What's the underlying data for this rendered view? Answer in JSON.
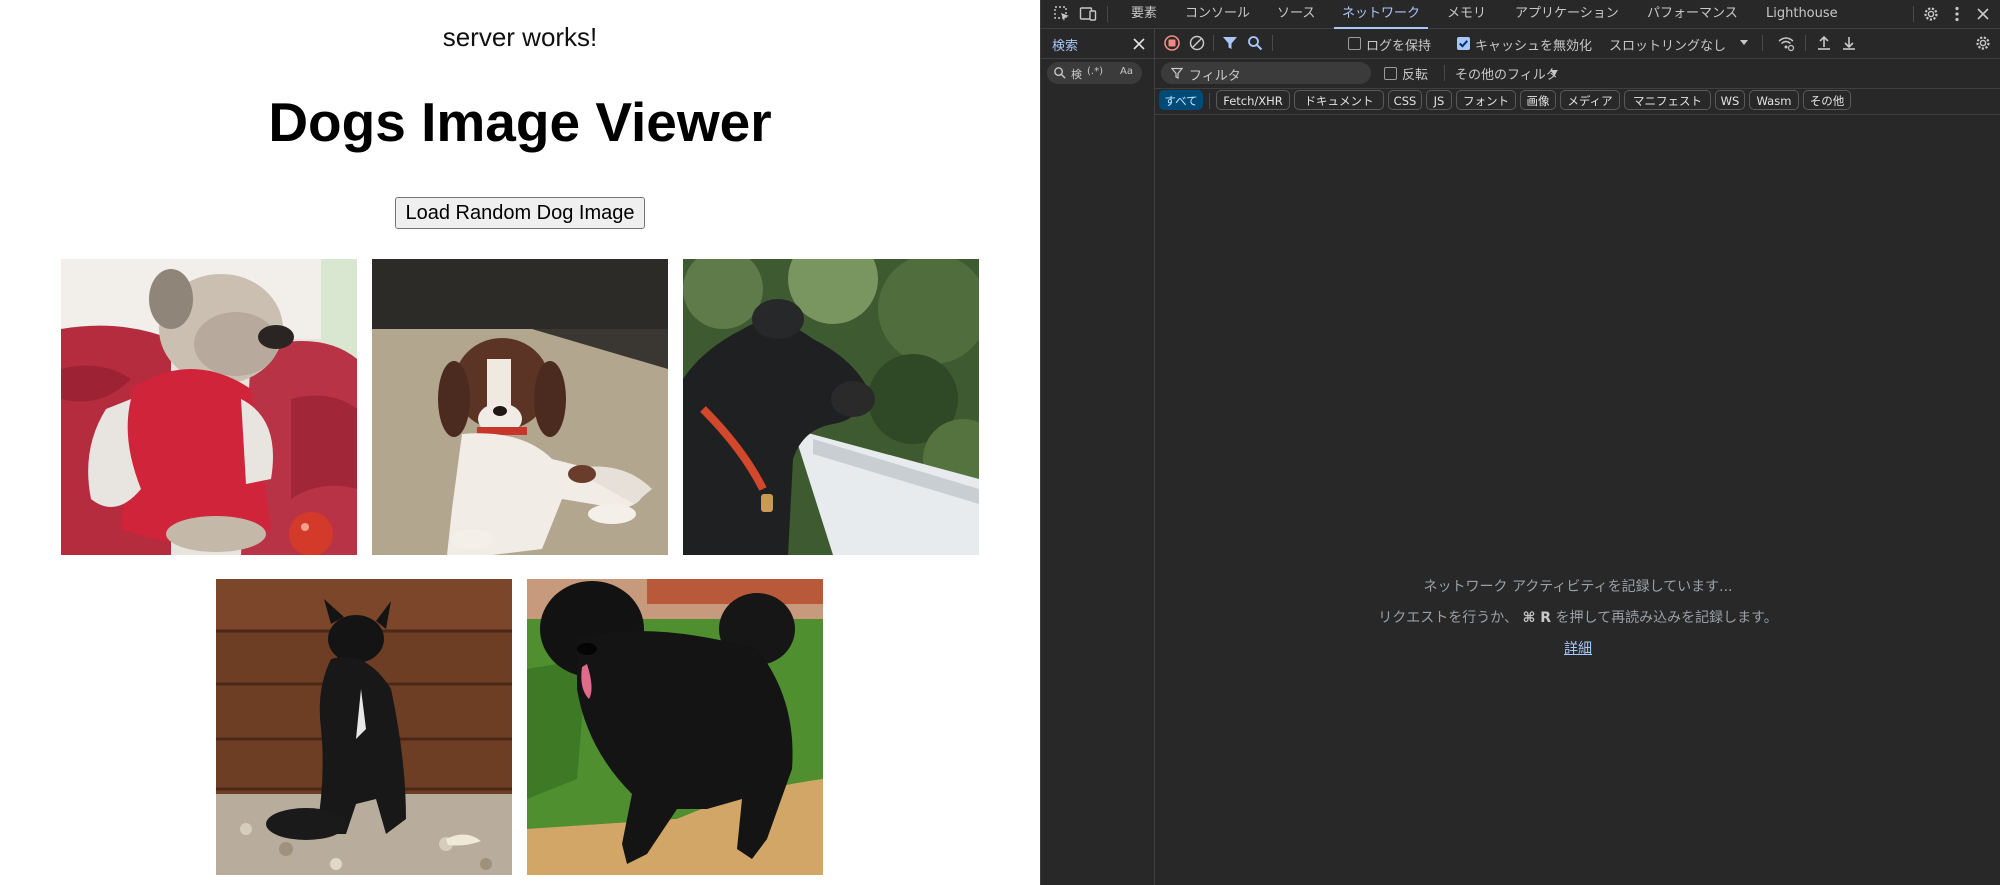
{
  "page": {
    "server_status": "server works!",
    "title": "Dogs Image Viewer",
    "load_button": "Load Random Dog Image",
    "images": [
      {
        "subject": "wire-haired terrier in red costume on sofa"
      },
      {
        "subject": "brown and white spaniel lying on carpet"
      },
      {
        "subject": "black terrier profile with red collar"
      },
      {
        "subject": "black dog sitting on gravel"
      },
      {
        "subject": "large black fluffy dog on dirt"
      }
    ]
  },
  "devtools": {
    "tabs": [
      "要素",
      "コンソール",
      "ソース",
      "ネットワーク",
      "メモリ",
      "アプリケーション",
      "パフォーマンス",
      "Lighthouse"
    ],
    "active_tab": "ネットワーク",
    "search_panel": {
      "label": "検索",
      "search_placeholder": "検",
      "regex_toggle": "(.*)",
      "case_toggle": "Aa"
    },
    "toolbar": {
      "preserve_log": "ログを保持",
      "preserve_log_checked": false,
      "disable_cache": "キャッシュを無効化",
      "disable_cache_checked": true,
      "throttling": "スロットリングなし"
    },
    "filter": {
      "placeholder": "フィルタ",
      "invert": "反転",
      "invert_checked": false,
      "more_filters": "その他のフィルタ"
    },
    "type_filters": [
      "すべて",
      "Fetch/XHR",
      "ドキュメント",
      "CSS",
      "JS",
      "フォント",
      "画像",
      "メディア",
      "マニフェスト",
      "WS",
      "Wasm",
      "その他"
    ],
    "active_type_filter": "すべて",
    "empty_state": {
      "line1": "ネットワーク アクティビティを記録しています...",
      "line2_prefix": "リクエストを行うか、",
      "shortcut": "⌘ R",
      "line2_suffix": "を押して再読み込みを記録します。",
      "link": "詳細"
    },
    "colors": {
      "accent": "#a8c7fa",
      "record": "#f28b82",
      "background": "#282828",
      "chip_active": "#004a77"
    }
  }
}
